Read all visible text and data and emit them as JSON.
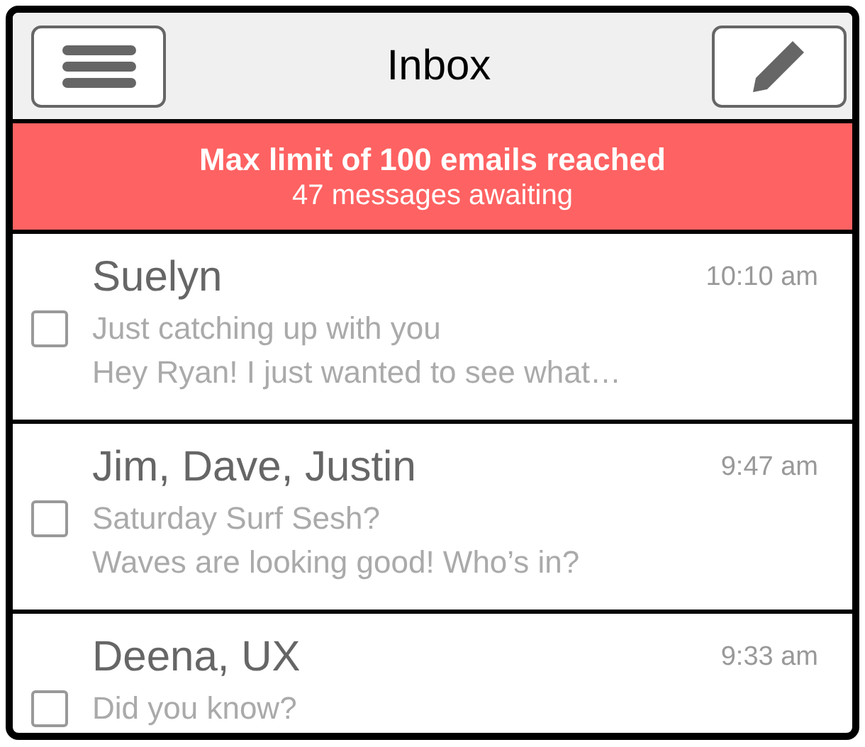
{
  "header": {
    "title": "Inbox"
  },
  "banner": {
    "title": "Max limit of 100 emails reached",
    "subtitle": "47 messages awaiting"
  },
  "messages": [
    {
      "sender": "Suelyn",
      "time": "10:10 am",
      "subject": "Just catching up with you",
      "preview": "Hey Ryan! I just wanted to see what…",
      "checked": false
    },
    {
      "sender": "Jim, Dave, Justin",
      "time": "9:47 am",
      "subject": "Saturday Surf Sesh?",
      "preview": "Waves are looking good! Who’s in?",
      "checked": false
    },
    {
      "sender": "Deena, UX",
      "time": "9:33 am",
      "subject": "Did you know?",
      "checked": false
    }
  ]
}
